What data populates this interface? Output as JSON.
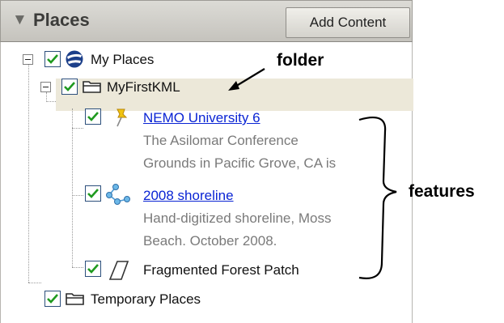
{
  "panel": {
    "title": "Places",
    "add_content_label": "Add Content"
  },
  "tree": {
    "my_places": "My Places",
    "folder": "MyFirstKML",
    "features": [
      {
        "title": "NEMO University 6",
        "desc_lines": [
          "The Asilomar Conference",
          "Grounds in Pacific Grove, CA is"
        ]
      },
      {
        "title": "2008 shoreline",
        "desc_lines": [
          "Hand-digitized shoreline, Moss",
          "Beach. October 2008."
        ]
      },
      {
        "title": "Fragmented Forest Patch"
      }
    ],
    "temporary": "Temporary Places"
  },
  "annotations": {
    "folder": "folder",
    "features": "features"
  },
  "colors": {
    "header_bg": "#d0cfca",
    "selected_row": "#ece8d9",
    "link": "#0a24d4",
    "checkbox_check": "#1f9a1f"
  }
}
